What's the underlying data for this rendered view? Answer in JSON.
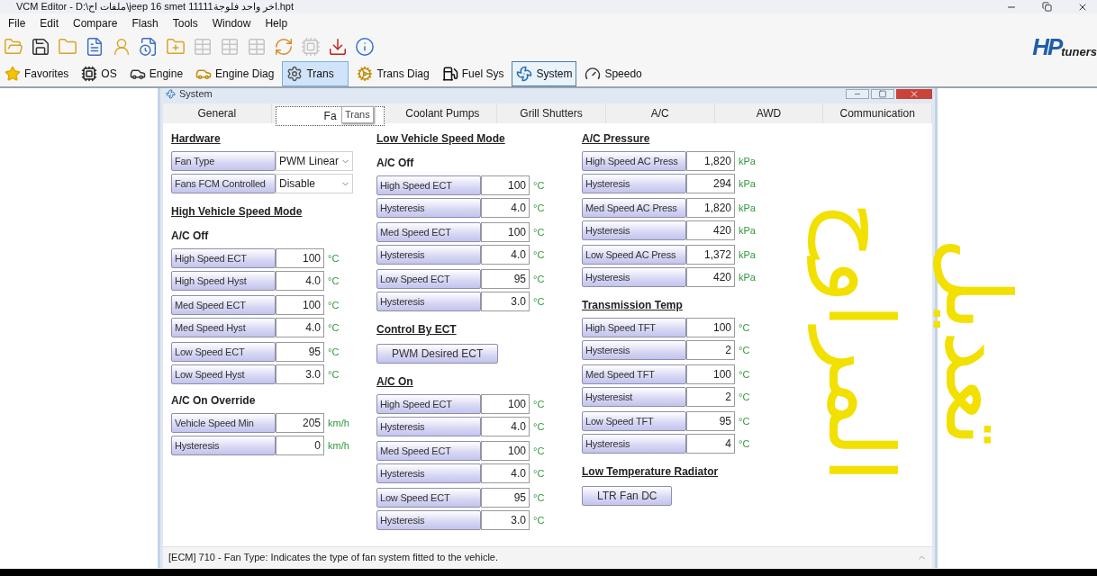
{
  "window": {
    "title": "VCM Editor - D:\\ملفات اح\\jeep 16 smet 11111اخر واحد فلوجة.hpt"
  },
  "menu": [
    "File",
    "Edit",
    "Compare",
    "Flash",
    "Tools",
    "Window",
    "Help"
  ],
  "toolbar": [
    {
      "kind": "open",
      "disabled": false
    },
    {
      "kind": "save",
      "disabled": false
    },
    {
      "kind": "folder",
      "disabled": false
    },
    {
      "kind": "info_doc",
      "disabled": false
    },
    {
      "kind": "user",
      "disabled": false
    },
    {
      "kind": "history",
      "disabled": false
    },
    {
      "kind": "new",
      "disabled": false
    },
    {
      "kind": "table",
      "disabled": true
    },
    {
      "kind": "table",
      "disabled": true
    },
    {
      "kind": "table",
      "disabled": true
    },
    {
      "kind": "convert",
      "disabled": false
    },
    {
      "kind": "chip",
      "disabled": true
    },
    {
      "kind": "flash",
      "disabled": false
    },
    {
      "kind": "about",
      "disabled": false
    }
  ],
  "logo": {
    "main": "HP",
    "sub": "tuners"
  },
  "nav": [
    {
      "kind": "favorites",
      "label": "Favorites",
      "selected": false,
      "hovered": false
    },
    {
      "kind": "os",
      "label": "OS",
      "selected": false,
      "hovered": false
    },
    {
      "kind": "engine",
      "label": "Engine",
      "selected": false,
      "hovered": false
    },
    {
      "kind": "engine_diag",
      "label": "Engine Diag",
      "selected": false,
      "hovered": false
    },
    {
      "kind": "trans",
      "label": "Trans",
      "selected": false,
      "hovered": true
    },
    {
      "kind": "trans_diag",
      "label": "Trans Diag",
      "selected": false,
      "hovered": false
    },
    {
      "kind": "fuel",
      "label": "Fuel Sys",
      "selected": false,
      "hovered": false
    },
    {
      "kind": "system",
      "label": "System",
      "selected": true,
      "hovered": false
    },
    {
      "kind": "speedo",
      "label": "Speedo",
      "selected": false,
      "hovered": false
    }
  ],
  "editor": {
    "title": "System",
    "tabs": [
      {
        "label": "General",
        "selected": false
      },
      {
        "label": "Fa",
        "selected": true
      },
      {
        "label": "Coolant Pumps",
        "selected": false
      },
      {
        "label": "Grill Shutters",
        "selected": false
      },
      {
        "label": "A/C",
        "selected": false
      },
      {
        "label": "AWD",
        "selected": false
      },
      {
        "label": "Communication",
        "selected": false
      }
    ],
    "tooltip": "Trans",
    "columns": [
      [
        {
          "kind": "heading",
          "text": "Hardware"
        },
        {
          "kind": "selects",
          "fields": [
            {
              "label": "Fan Type",
              "value": "PWM Linear"
            },
            {
              "label": "Fans FCM Controlled",
              "value": "Disable"
            }
          ]
        },
        {
          "kind": "heading",
          "text": "High Vehicle Speed Mode"
        },
        {
          "kind": "subheading",
          "text": "A/C Off"
        },
        {
          "kind": "group",
          "fields": [
            {
              "label": "High Speed ECT",
              "value": "100",
              "unit": "°C"
            },
            {
              "label": "High Speed Hyst",
              "value": "4.0",
              "unit": "°C"
            }
          ]
        },
        {
          "kind": "group",
          "fields": [
            {
              "label": "Med Speed ECT",
              "value": "100",
              "unit": "°C"
            },
            {
              "label": "Med Speed Hyst",
              "value": "4.0",
              "unit": "°C"
            }
          ]
        },
        {
          "kind": "group",
          "fields": [
            {
              "label": "Low Speed ECT",
              "value": "95",
              "unit": "°C"
            },
            {
              "label": "Low Speed Hyst",
              "value": "3.0",
              "unit": "°C"
            }
          ]
        },
        {
          "kind": "subheading",
          "text": "A/C On Override"
        },
        {
          "kind": "group",
          "fields": [
            {
              "label": "Vehicle Speed Min",
              "value": "205",
              "unit": "km/h"
            },
            {
              "label": "Hysteresis",
              "value": "0",
              "unit": "km/h"
            }
          ]
        }
      ],
      [
        {
          "kind": "heading",
          "text": "Low Vehicle Speed Mode"
        },
        {
          "kind": "subheading",
          "text": "A/C Off"
        },
        {
          "kind": "group",
          "fields": [
            {
              "label": "High Speed ECT",
              "value": "100",
              "unit": "°C"
            },
            {
              "label": "Hysteresis",
              "value": "4.0",
              "unit": "°C"
            }
          ]
        },
        {
          "kind": "group",
          "fields": [
            {
              "label": "Med Speed ECT",
              "value": "100",
              "unit": "°C"
            },
            {
              "label": "Hysteresis",
              "value": "4.0",
              "unit": "°C"
            }
          ]
        },
        {
          "kind": "group",
          "fields": [
            {
              "label": "Low Speed ECT",
              "value": "95",
              "unit": "°C"
            },
            {
              "label": "Hysteresis",
              "value": "3.0",
              "unit": "°C"
            }
          ]
        },
        {
          "kind": "heading",
          "text": "Control By ECT"
        },
        {
          "kind": "button",
          "label": "PWM Desired ECT"
        },
        {
          "kind": "heading",
          "text": "A/C On"
        },
        {
          "kind": "group",
          "fields": [
            {
              "label": "High Speed ECT",
              "value": "100",
              "unit": "°C"
            },
            {
              "label": "Hysteresis",
              "value": "4.0",
              "unit": "°C"
            }
          ]
        },
        {
          "kind": "group",
          "fields": [
            {
              "label": "Med Speed ECT",
              "value": "100",
              "unit": "°C"
            },
            {
              "label": "Hysteresis",
              "value": "4.0",
              "unit": "°C"
            }
          ]
        },
        {
          "kind": "group",
          "fields": [
            {
              "label": "Low Speed ECT",
              "value": "95",
              "unit": "°C"
            },
            {
              "label": "Hysteresis",
              "value": "3.0",
              "unit": "°C"
            }
          ]
        }
      ],
      [
        {
          "kind": "heading",
          "text": "A/C Pressure"
        },
        {
          "kind": "group",
          "fields": [
            {
              "label": "High Speed AC Press",
              "value": "1,820",
              "unit": "kPa"
            },
            {
              "label": "Hysteresis",
              "value": "294",
              "unit": "kPa"
            }
          ]
        },
        {
          "kind": "group",
          "fields": [
            {
              "label": "Med Speed AC Press",
              "value": "1,820",
              "unit": "kPa"
            },
            {
              "label": "Hysteresis",
              "value": "420",
              "unit": "kPa"
            }
          ]
        },
        {
          "kind": "group",
          "fields": [
            {
              "label": "Low Speed AC Press",
              "value": "1,372",
              "unit": "kPa"
            },
            {
              "label": "Hysteresis",
              "value": "420",
              "unit": "kPa"
            }
          ]
        },
        {
          "kind": "heading",
          "text": "Transmission Temp"
        },
        {
          "kind": "group",
          "fields": [
            {
              "label": "High Speed TFT",
              "value": "100",
              "unit": "°C"
            },
            {
              "label": "Hysteresis",
              "value": "2",
              "unit": "°C"
            }
          ]
        },
        {
          "kind": "group",
          "fields": [
            {
              "label": "Med Speed TFT",
              "value": "100",
              "unit": "°C"
            },
            {
              "label": "Hysteresist",
              "value": "2",
              "unit": "°C"
            }
          ]
        },
        {
          "kind": "group",
          "fields": [
            {
              "label": "Low Speed TFT",
              "value": "95",
              "unit": "°C"
            },
            {
              "label": "Hysteresis",
              "value": "4",
              "unit": "°C"
            }
          ]
        },
        {
          "kind": "heading",
          "text": "Low Temperature Radiator"
        },
        {
          "kind": "button",
          "label": "LTR Fan DC"
        }
      ]
    ],
    "status": "[ECM] 710 - Fan Type: Indicates the type of fan system fitted to the vehicle."
  },
  "annotation": {
    "text": "تعديل المراوح"
  }
}
